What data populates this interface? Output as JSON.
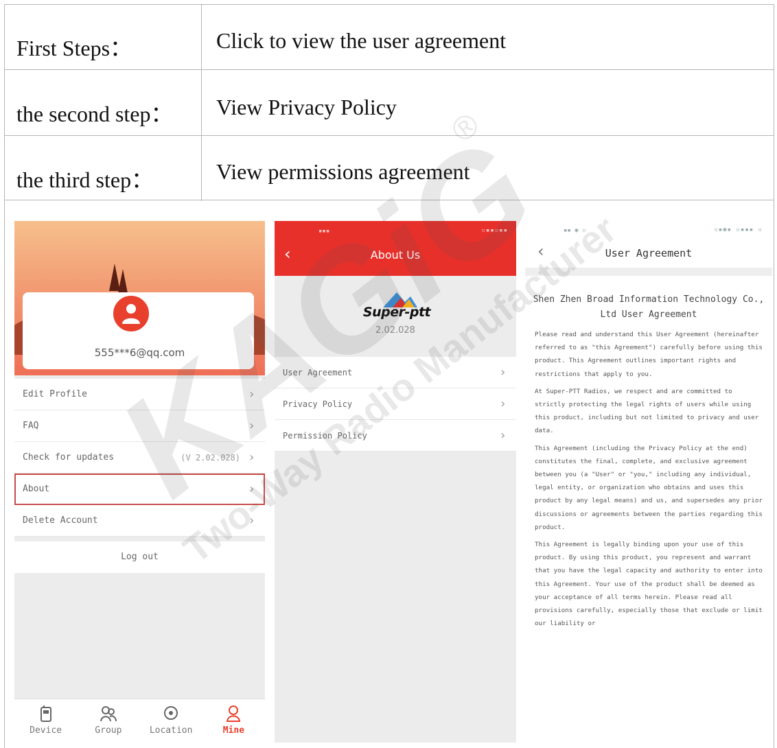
{
  "steps": [
    {
      "label": "First Steps：",
      "value": "Click to view the user agreement"
    },
    {
      "label": "the second step：",
      "value": "View Privacy Policy"
    },
    {
      "label": "the third step：",
      "value": "View permissions agreement"
    }
  ],
  "mine_screen": {
    "email": "555***6@qq.com",
    "menu": {
      "edit_profile": "Edit Profile",
      "faq": "FAQ",
      "check_updates": "Check for updates",
      "check_updates_version": "(V 2.02.028)",
      "about": "About",
      "delete_account": "Delete Account"
    },
    "logout": "Log out",
    "tabs": {
      "device": "Device",
      "group": "Group",
      "location": "Location",
      "mine": "Mine"
    }
  },
  "about_screen": {
    "title": "About Us",
    "logo": "Super-ptt",
    "version": "2.02.028",
    "menu": {
      "user_agreement": "User Agreement",
      "privacy_policy": "Privacy Policy",
      "permission_policy": "Permission Policy"
    }
  },
  "agreement_screen": {
    "title": "User Agreement",
    "heading": "Shen Zhen Broad Information Technology Co., Ltd User Agreement",
    "paragraphs": [
      "Please read and understand this User Agreement (hereinafter referred to as \"this Agreement\") carefully before using this product. This Agreement outlines important rights and restrictions that apply to you.",
      "At Super-PTT Radios, we respect and are committed to strictly protecting the legal rights of users while using this product, including but not limited to privacy and user data.",
      "This Agreement (including the Privacy Policy at the end) constitutes the final, complete, and exclusive agreement between you (a \"User\" or \"you,\" including any individual, legal entity, or organization who obtains and uses this product by any legal means) and us, and supersedes any prior discussions or agreements between the parties regarding this product.",
      "This Agreement is legally binding upon your use of this product. By using this product, you represent and warrant that you have the legal capacity and authority to enter into this Agreement. Your use of the product shall be deemed as your acceptance of all terms herein. Please read all provisions carefully, especially those that exclude or limit our liability or"
    ]
  },
  "watermark": {
    "brand": "KAGiG",
    "tagline": "Two-Way Radio Manufacturer",
    "registered": "®"
  },
  "colors": {
    "accent_red": "#e8302b",
    "table_border": "#b5b5b5"
  }
}
